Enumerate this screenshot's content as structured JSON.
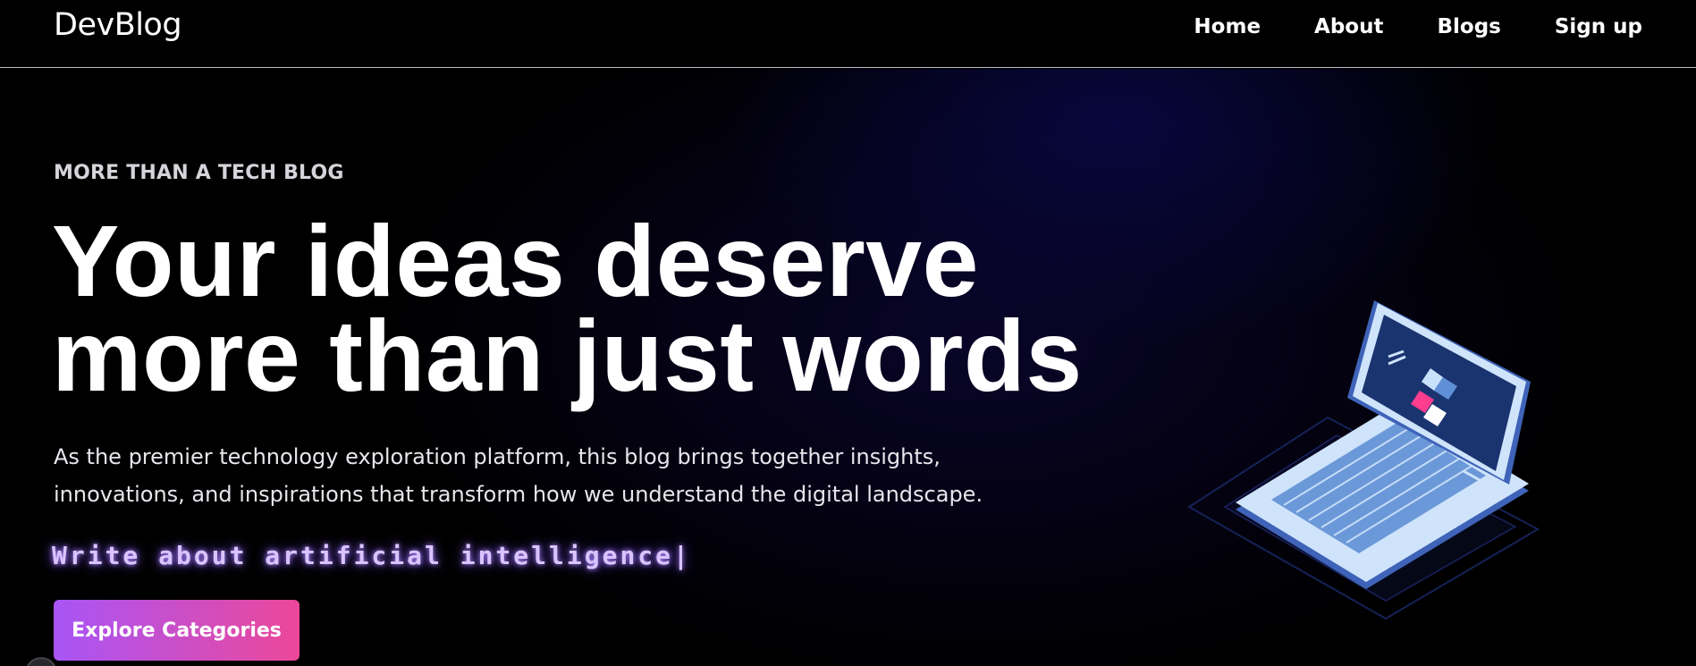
{
  "nav": {
    "brand": "DevBlog",
    "links": [
      {
        "label": "Home"
      },
      {
        "label": "About"
      },
      {
        "label": "Blogs"
      },
      {
        "label": "Sign up"
      }
    ]
  },
  "hero": {
    "eyebrow": "MORE THAN A TECH BLOG",
    "headline_line1": "Your ideas deserve",
    "headline_line2": "more than just words",
    "description_line1": "As the premier technology exploration platform, this blog brings together insights,",
    "description_line2": "innovations, and inspirations that transform how we understand the digital landscape.",
    "typewriter_text": "Write about artificial intelligence",
    "typewriter_cursor": "|",
    "cta_label": "Explore Categories",
    "illustration": "laptop-illustration-icon"
  },
  "colors": {
    "background": "#000000",
    "accent_start": "#a855f7",
    "accent_end": "#ec4899",
    "typewriter_glow": "#b18cff"
  }
}
